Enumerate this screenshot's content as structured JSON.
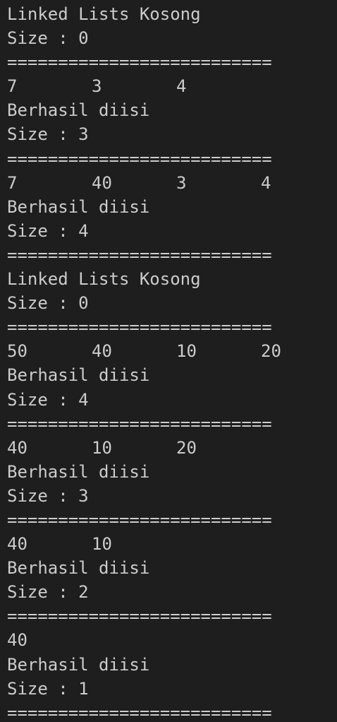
{
  "terminal": {
    "lines": [
      {
        "text": "Linked Lists Kosong"
      },
      {
        "text": "Size : 0"
      },
      {
        "text": "=========================="
      },
      {
        "cells": [
          "7",
          "3",
          "4"
        ]
      },
      {
        "text": "Berhasil diisi"
      },
      {
        "text": "Size : 3"
      },
      {
        "text": "=========================="
      },
      {
        "cells": [
          "7",
          "40",
          "3",
          "4"
        ]
      },
      {
        "text": "Berhasil diisi"
      },
      {
        "text": "Size : 4"
      },
      {
        "text": "=========================="
      },
      {
        "text": "Linked Lists Kosong"
      },
      {
        "text": "Size : 0"
      },
      {
        "text": "=========================="
      },
      {
        "cells": [
          "50",
          "40",
          "10",
          "20"
        ]
      },
      {
        "text": "Berhasil diisi"
      },
      {
        "text": "Size : 4"
      },
      {
        "text": "=========================="
      },
      {
        "cells": [
          "40",
          "10",
          "20"
        ]
      },
      {
        "text": "Berhasil diisi"
      },
      {
        "text": "Size : 3"
      },
      {
        "text": "=========================="
      },
      {
        "cells": [
          "40",
          "10"
        ]
      },
      {
        "text": "Berhasil diisi"
      },
      {
        "text": "Size : 2"
      },
      {
        "text": "=========================="
      },
      {
        "cells": [
          "40"
        ]
      },
      {
        "text": "Berhasil diisi"
      },
      {
        "text": "Size : 1"
      },
      {
        "text": "=========================="
      }
    ]
  }
}
